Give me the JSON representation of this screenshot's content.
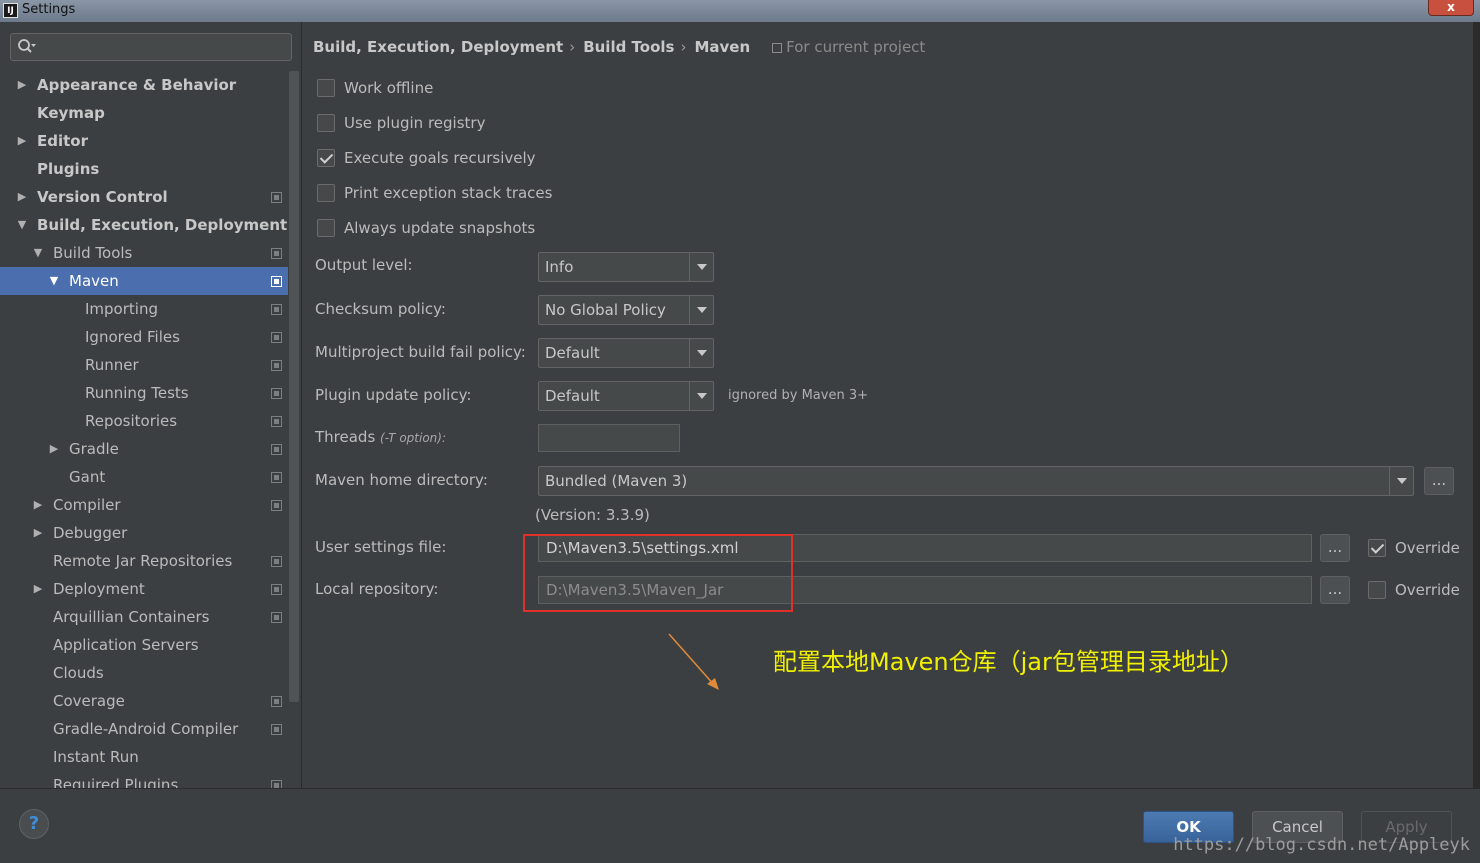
{
  "window": {
    "title": "Settings",
    "app_icon": "IJ",
    "close_label": "x"
  },
  "tree": [
    {
      "label": "Appearance & Behavior",
      "arrow": "▶",
      "bold": true,
      "level": 0,
      "proj": false
    },
    {
      "label": "Keymap",
      "arrow": "",
      "bold": true,
      "level": 0,
      "proj": false
    },
    {
      "label": "Editor",
      "arrow": "▶",
      "bold": true,
      "level": 0,
      "proj": false
    },
    {
      "label": "Plugins",
      "arrow": "",
      "bold": true,
      "level": 0,
      "proj": false
    },
    {
      "label": "Version Control",
      "arrow": "▶",
      "bold": true,
      "level": 0,
      "proj": true
    },
    {
      "label": "Build, Execution, Deployment",
      "arrow": "▼",
      "bold": true,
      "level": 0,
      "proj": false
    },
    {
      "label": "Build Tools",
      "arrow": "▼",
      "bold": false,
      "level": 1,
      "proj": true
    },
    {
      "label": "Maven",
      "arrow": "▼",
      "bold": false,
      "level": 2,
      "proj": true,
      "selected": true
    },
    {
      "label": "Importing",
      "arrow": "",
      "bold": false,
      "level": 3,
      "proj": true
    },
    {
      "label": "Ignored Files",
      "arrow": "",
      "bold": false,
      "level": 3,
      "proj": true
    },
    {
      "label": "Runner",
      "arrow": "",
      "bold": false,
      "level": 3,
      "proj": true
    },
    {
      "label": "Running Tests",
      "arrow": "",
      "bold": false,
      "level": 3,
      "proj": true
    },
    {
      "label": "Repositories",
      "arrow": "",
      "bold": false,
      "level": 3,
      "proj": true
    },
    {
      "label": "Gradle",
      "arrow": "▶",
      "bold": false,
      "level": 2,
      "proj": true
    },
    {
      "label": "Gant",
      "arrow": "",
      "bold": false,
      "level": 2,
      "proj": true
    },
    {
      "label": "Compiler",
      "arrow": "▶",
      "bold": false,
      "level": 1,
      "proj": true
    },
    {
      "label": "Debugger",
      "arrow": "▶",
      "bold": false,
      "level": 1,
      "proj": false
    },
    {
      "label": "Remote Jar Repositories",
      "arrow": "",
      "bold": false,
      "level": 1,
      "proj": true
    },
    {
      "label": "Deployment",
      "arrow": "▶",
      "bold": false,
      "level": 1,
      "proj": true
    },
    {
      "label": "Arquillian Containers",
      "arrow": "",
      "bold": false,
      "level": 1,
      "proj": true
    },
    {
      "label": "Application Servers",
      "arrow": "",
      "bold": false,
      "level": 1,
      "proj": false
    },
    {
      "label": "Clouds",
      "arrow": "",
      "bold": false,
      "level": 1,
      "proj": false
    },
    {
      "label": "Coverage",
      "arrow": "",
      "bold": false,
      "level": 1,
      "proj": true
    },
    {
      "label": "Gradle-Android Compiler",
      "arrow": "",
      "bold": false,
      "level": 1,
      "proj": true
    },
    {
      "label": "Instant Run",
      "arrow": "",
      "bold": false,
      "level": 1,
      "proj": false
    },
    {
      "label": "Required Plugins",
      "arrow": "",
      "bold": false,
      "level": 1,
      "proj": true
    }
  ],
  "breadcrumb": {
    "parts": [
      "Build, Execution, Deployment",
      "Build Tools",
      "Maven"
    ],
    "separator": "›",
    "scope": "For current project"
  },
  "checkboxes": [
    {
      "label": "Work offline",
      "checked": false
    },
    {
      "label": "Use plugin registry",
      "checked": false
    },
    {
      "label": "Execute goals recursively",
      "checked": true
    },
    {
      "label": "Print exception stack traces",
      "checked": false
    },
    {
      "label": "Always update snapshots",
      "checked": false
    }
  ],
  "fields": {
    "output_level": {
      "label": "Output level:",
      "value": "Info"
    },
    "checksum_policy": {
      "label": "Checksum policy:",
      "value": "No Global Policy"
    },
    "multiproject_fail": {
      "label": "Multiproject build fail policy:",
      "value": "Default"
    },
    "plugin_update": {
      "label": "Plugin update policy:",
      "value": "Default",
      "hint": "ignored by Maven 3+"
    },
    "threads": {
      "label": "Threads",
      "hint": "(-T option):",
      "value": ""
    },
    "maven_home": {
      "label": "Maven home directory:",
      "value": "Bundled (Maven 3)",
      "version": "(Version: 3.3.9)"
    },
    "user_settings": {
      "label": "User settings file:",
      "value": "D:\\Maven3.5\\settings.xml",
      "override_label": "Override",
      "override_checked": true
    },
    "local_repo": {
      "label": "Local repository:",
      "value": "D:\\Maven3.5\\Maven_Jar",
      "override_label": "Override",
      "override_checked": false
    },
    "browse_label": "..."
  },
  "annotation": "配置本地Maven仓库（jar包管理目录地址）",
  "buttons": {
    "ok": "OK",
    "cancel": "Cancel",
    "apply": "Apply",
    "help": "?"
  },
  "watermark": "https://blog.csdn.net/Appleyk"
}
